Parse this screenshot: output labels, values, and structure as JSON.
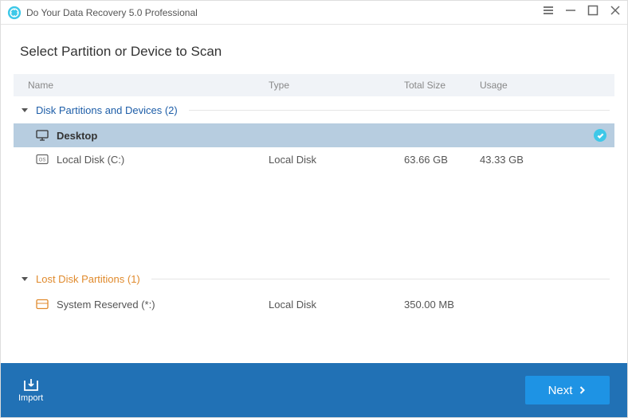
{
  "titlebar": {
    "title": "Do Your Data Recovery 5.0 Professional"
  },
  "heading": "Select Partition or Device to Scan",
  "columns": {
    "name": "Name",
    "type": "Type",
    "size": "Total Size",
    "usage": "Usage"
  },
  "sections": {
    "disks": {
      "label": "Disk Partitions and Devices (2)"
    },
    "lost": {
      "label": "Lost Disk Partitions (1)"
    }
  },
  "items": {
    "desktop": {
      "name": "Desktop",
      "type": "",
      "size": "",
      "usage": "",
      "selected": true
    },
    "localc": {
      "name": "Local Disk (C:)",
      "type": "Local Disk",
      "size": "63.66 GB",
      "usage": "43.33 GB"
    },
    "sysres": {
      "name": "System Reserved (*:)",
      "type": "Local Disk",
      "size": "350.00 MB",
      "usage": ""
    }
  },
  "footer": {
    "import": "Import",
    "next": "Next"
  }
}
